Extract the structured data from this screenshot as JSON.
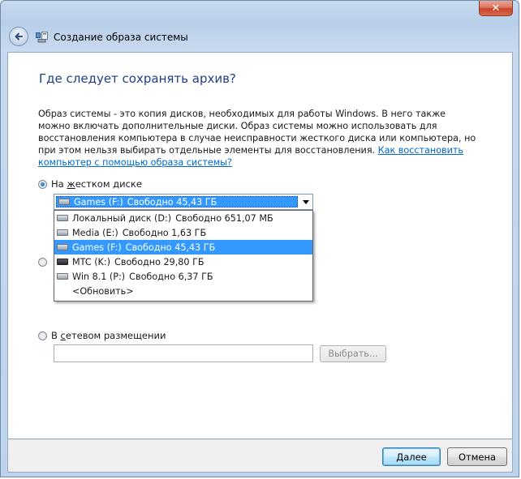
{
  "window": {
    "title": "Создание образа системы",
    "close_label": "✕"
  },
  "page": {
    "heading": "Где следует сохранять архив?",
    "description": "Образ системы - это копия дисков, необходимых для работы Windows. В него также можно включать дополнительные диски. Образ системы можно использовать для восстановления компьютера в случае неисправности жесткого диска или компьютера, но при этом нельзя выбирать отдельные элементы для восстановления.",
    "help_link": "Как восстановить компьютер с помощью образа системы?"
  },
  "options": {
    "hard_disk": {
      "label_pre": "На ",
      "label_ul": "ж",
      "label_post": "естком диске",
      "checked": true
    },
    "network": {
      "label_pre": "В ",
      "label_ul": "с",
      "label_post": "етевом размещении",
      "checked": false
    }
  },
  "combo": {
    "selected": {
      "name": "Games (F:)",
      "free": "Свободно 45,43 ГБ",
      "icon": "hdd-drive-icon"
    }
  },
  "dropdown": {
    "items": [
      {
        "name": "Локальный диск (D:)",
        "free": "Свободно 651,07 МБ",
        "icon": "hdd-drive-icon"
      },
      {
        "name": "Media (E:)",
        "free": "Свободно 1,63 ГБ",
        "icon": "hdd-drive-icon"
      },
      {
        "name": "Games (F:)",
        "free": "Свободно 45,43 ГБ",
        "icon": "hdd-drive-icon",
        "selected": true
      },
      {
        "name": "MTC (K:)",
        "free": "Свободно 29,80 ГБ",
        "icon": "usb-drive-icon"
      },
      {
        "name": "Win 8.1 (P:)",
        "free": "Свободно 6,37 ГБ",
        "icon": "hdd-drive-icon"
      }
    ],
    "refresh_label": "<Обновить>"
  },
  "network": {
    "path_value": "",
    "browse_label": "Выбрать..."
  },
  "footer": {
    "next_label": "Далее",
    "cancel_label": "Отмена"
  },
  "colors": {
    "heading": "#1f3f88",
    "link": "#0066cc",
    "selection": "#3399ff"
  }
}
